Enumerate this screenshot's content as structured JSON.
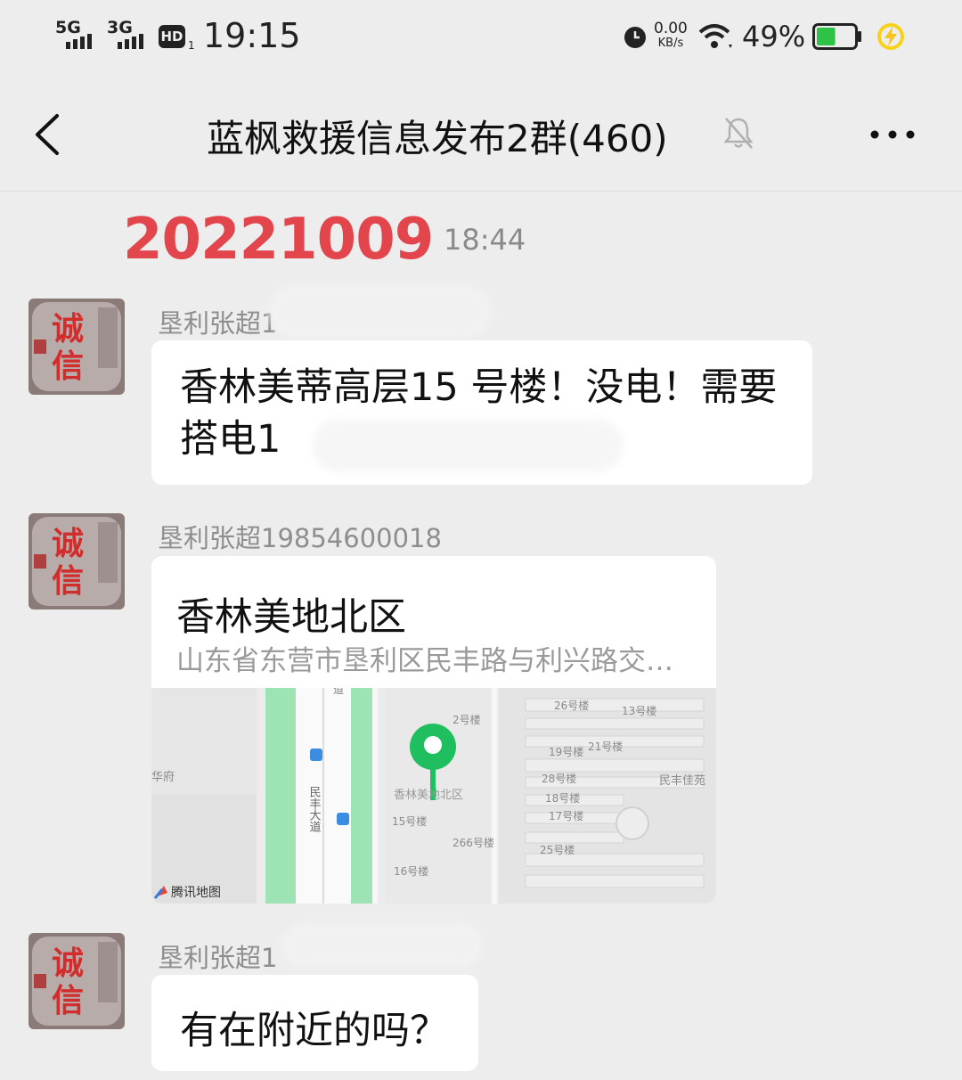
{
  "status_bar": {
    "net1": "5G",
    "net2": "3G",
    "hd": "HD",
    "hd_sub": "1",
    "time": "19:15",
    "speed_value": "0.00",
    "speed_unit": "KB/s",
    "battery_percent": "49%",
    "battery_level": 0.49,
    "icons": [
      "signal-icon",
      "alarm-icon",
      "wifi-icon",
      "battery-icon",
      "charging-icon"
    ]
  },
  "header": {
    "title": "蓝枫救援信息发布2群(460)",
    "icons": [
      "back-icon",
      "mute-bell-icon",
      "more-icon"
    ]
  },
  "date_stamp": "20221009",
  "timestamp": "18:44",
  "messages": [
    {
      "sender": "垦利张超1",
      "type": "text",
      "text": "香林美蒂高层15 号楼！没电！需要搭电1"
    },
    {
      "sender": "垦利张超19854600018",
      "type": "location",
      "place_name": "香林美地北区",
      "address": "山东省东营市垦利区民丰路与利兴路交…",
      "map": {
        "labels": {
          "b2": "2号楼",
          "b26": "26号楼",
          "b13": "13号楼",
          "b19": "19号楼",
          "b21": "21号楼",
          "huafu": "华府",
          "area": "香林美地北区",
          "minfeng_jiayuan": "民丰佳苑",
          "b28": "28号楼",
          "b18": "18号楼",
          "b17": "17号楼",
          "b15": "15号楼",
          "b266": "266号楼",
          "b25": "25号楼",
          "b16": "16号楼",
          "road": "民丰大道",
          "road_top": "道",
          "logo": "腾讯地图"
        }
      }
    },
    {
      "sender": "垦利张超1",
      "type": "text",
      "text": "有在附近的吗？"
    }
  ],
  "avatar_text": [
    "诚",
    "信"
  ],
  "colors": {
    "background": "#ededed",
    "bubble": "#ffffff",
    "date_red": "#e2454c",
    "pin_green": "#1fbf5f",
    "road_green": "#9ee3b4"
  }
}
